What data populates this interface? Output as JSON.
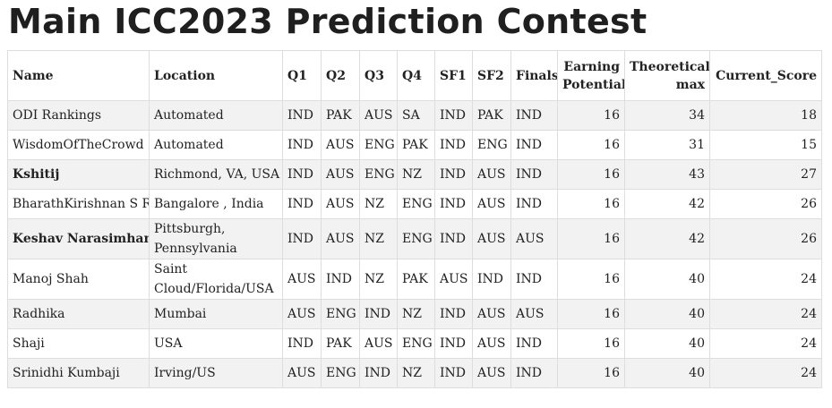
{
  "page_title": "Main ICC2023 Prediction Contest",
  "columns": {
    "name": "Name",
    "location": "Location",
    "q1": "Q1",
    "q2": "Q2",
    "q3": "Q3",
    "q4": "Q4",
    "sf1": "SF1",
    "sf2": "SF2",
    "finals": "Finals",
    "earning_potential": "Earning Potential",
    "theoretical_max": "Theoretical max",
    "current_score": "Current_Score"
  },
  "rows": [
    {
      "name": "ODI Rankings",
      "location": "Automated",
      "q1": "IND",
      "q2": "PAK",
      "q3": "AUS",
      "q4": "SA",
      "sf1": "IND",
      "sf2": "PAK",
      "finals": "IND",
      "earning_potential": "16",
      "theoretical_max": "34",
      "current_score": "18"
    },
    {
      "name": "WisdomOfTheCrowd",
      "location": "Automated",
      "q1": "IND",
      "q2": "AUS",
      "q3": "ENG",
      "q4": "PAK",
      "sf1": "IND",
      "sf2": "ENG",
      "finals": "IND",
      "earning_potential": "16",
      "theoretical_max": "31",
      "current_score": "15"
    },
    {
      "name": "Kshitij",
      "location": "Richmond, VA, USA",
      "q1": "IND",
      "q2": "AUS",
      "q3": "ENG",
      "q4": "NZ",
      "sf1": "IND",
      "sf2": "AUS",
      "finals": "IND",
      "earning_potential": "16",
      "theoretical_max": "43",
      "current_score": "27"
    },
    {
      "name": "BharathKirishnan S R",
      "location": "Bangalore , India",
      "q1": "IND",
      "q2": "AUS",
      "q3": "NZ",
      "q4": "ENG",
      "sf1": "IND",
      "sf2": "AUS",
      "finals": "IND",
      "earning_potential": "16",
      "theoretical_max": "42",
      "current_score": "26"
    },
    {
      "name": "Keshav Narasimhan",
      "location": "Pittsburgh, Pennsylvania",
      "q1": "IND",
      "q2": "AUS",
      "q3": "NZ",
      "q4": "ENG",
      "sf1": "IND",
      "sf2": "AUS",
      "finals": "AUS",
      "earning_potential": "16",
      "theoretical_max": "42",
      "current_score": "26"
    },
    {
      "name": "Manoj Shah",
      "location": "Saint Cloud/Florida/USA",
      "q1": "AUS",
      "q2": "IND",
      "q3": "NZ",
      "q4": "PAK",
      "sf1": "AUS",
      "sf2": "IND",
      "finals": "IND",
      "earning_potential": "16",
      "theoretical_max": "40",
      "current_score": "24"
    },
    {
      "name": "Radhika",
      "location": "Mumbai",
      "q1": "AUS",
      "q2": "ENG",
      "q3": "IND",
      "q4": "NZ",
      "sf1": "IND",
      "sf2": "AUS",
      "finals": "AUS",
      "earning_potential": "16",
      "theoretical_max": "40",
      "current_score": "24"
    },
    {
      "name": "Shaji",
      "location": "USA",
      "q1": "IND",
      "q2": "PAK",
      "q3": "AUS",
      "q4": "ENG",
      "sf1": "IND",
      "sf2": "AUS",
      "finals": "IND",
      "earning_potential": "16",
      "theoretical_max": "40",
      "current_score": "24"
    },
    {
      "name": "Srinidhi Kumbaji",
      "location": "Irving/US",
      "q1": "AUS",
      "q2": "ENG",
      "q3": "IND",
      "q4": "NZ",
      "sf1": "IND",
      "sf2": "AUS",
      "finals": "IND",
      "earning_potential": "16",
      "theoretical_max": "40",
      "current_score": "24"
    }
  ]
}
